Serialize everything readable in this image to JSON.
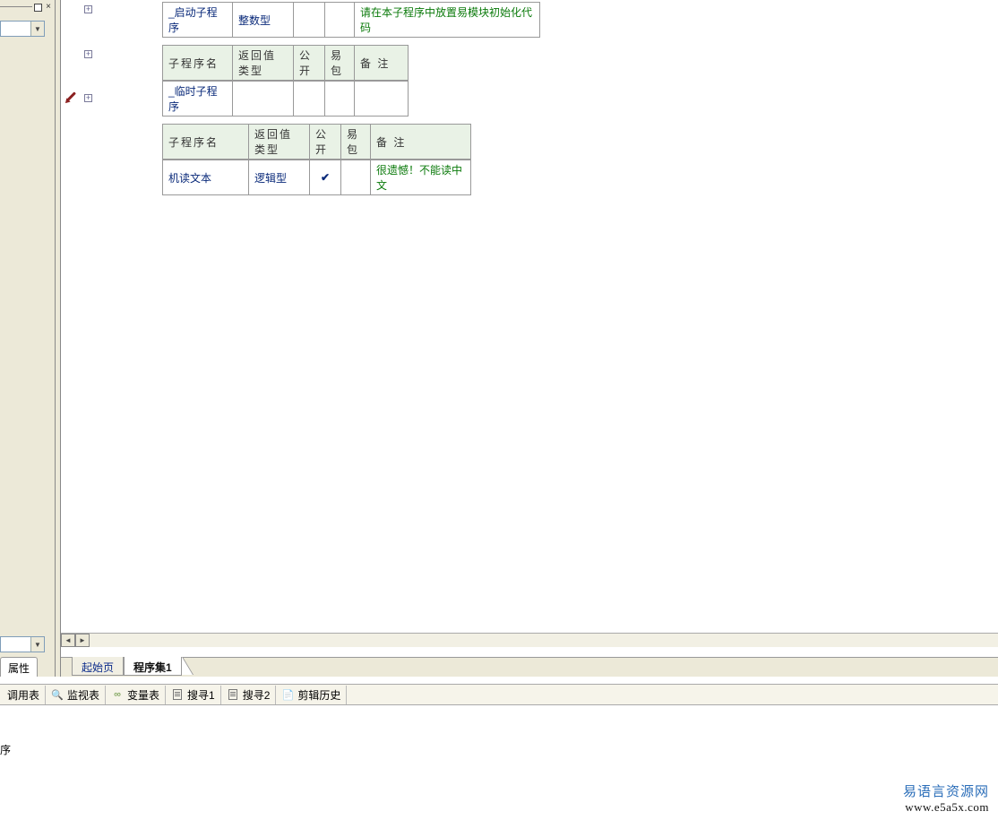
{
  "left": {
    "close_glyph": "×",
    "dropdown_arrow": "▼",
    "tab_property": "属性"
  },
  "gutter": {
    "plus": "+"
  },
  "subs": [
    {
      "name": "_启动子程序",
      "ret": "整数型",
      "pub": "",
      "pkg": "",
      "remark": "请在本子程序中放置易模块初始化代码",
      "has_header": false
    },
    {
      "name": "_临时子程序",
      "ret": "",
      "pub": "",
      "pkg": "",
      "remark": "",
      "has_header": true
    },
    {
      "name": "机读文本",
      "ret": "逻辑型",
      "pub": "✔",
      "pkg": "",
      "remark": "很遗憾！不能读中文",
      "has_header": true
    }
  ],
  "headers": {
    "name": "子程序名",
    "ret": "返回值类型",
    "pub": "公开",
    "pkg": "易包",
    "remark": "备 注"
  },
  "tabs": {
    "start": "起始页",
    "module": "程序集1"
  },
  "toolbar": {
    "call_table": "调用表",
    "watch_table": "监视表",
    "var_table": "变量表",
    "search1": "搜寻1",
    "search2": "搜寻2",
    "clip_history": "剪辑历史"
  },
  "status": "序",
  "watermark": {
    "line1": "易语言资源网",
    "line2": "www.e5a5x.com"
  },
  "scroll": {
    "left": "◄",
    "right": "►"
  }
}
